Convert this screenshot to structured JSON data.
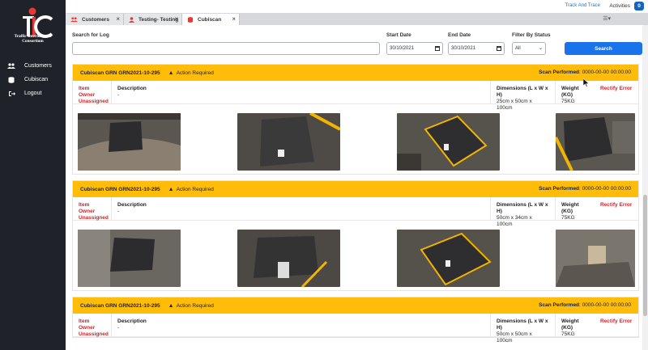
{
  "brand": {
    "logo_letters": "TIC",
    "line1": "Traffic International",
    "line2": "Consortium"
  },
  "sidebar": {
    "items": [
      {
        "label": "Customers",
        "icon": "users-icon"
      },
      {
        "label": "Cubiscan",
        "icon": "database-icon"
      },
      {
        "label": "Logout",
        "icon": "logout-icon"
      }
    ]
  },
  "topbar": {
    "track_link": "Track And Trace",
    "activities_label": "Activities",
    "activities_count": "0"
  },
  "tabs": [
    {
      "label": "Customers",
      "icon": "users-icon",
      "active": false
    },
    {
      "label": "Testing- Testing",
      "icon": "user-icon",
      "active": false
    },
    {
      "label": "Cubiscan",
      "icon": "database-icon",
      "active": true
    }
  ],
  "filters": {
    "search_label": "Search for Log",
    "search_value": "",
    "start_label": "Start Date",
    "start_value": "30/10/2021",
    "end_label": "End Date",
    "end_value": "30/10/2021",
    "status_label": "Filter By Status",
    "status_value": "All",
    "search_button": "Search"
  },
  "common": {
    "action_required": "Action Required",
    "scan_performed_label": "Scan Performed",
    "owner_label": "Item Owner",
    "owner_value": "Unassigned",
    "desc_label": "Description",
    "dim_label": "Dimensions (L x W x H)",
    "weight_label": "Weight (KG)",
    "rectify": "Rectify Error"
  },
  "logs": [
    {
      "grn": "Cubiscan GRN  GRN2021-10-295",
      "scan": ": 0000-00-00 00:00:00",
      "description": "-",
      "dimensions": "25cm x 50cm x 100cm",
      "weight": "75KG"
    },
    {
      "grn": "Cubiscan GRN  GRN2021-10-295",
      "scan": ": 0000-00-00 00:00:00",
      "description": "-",
      "dimensions": "50cm x 34cm x 100cm",
      "weight": "75KG"
    },
    {
      "grn": "Cubiscan GRN  GRN2021-10-295",
      "scan": ": 0000-00-00 00:00:00",
      "description": "-",
      "dimensions": "50cm x 50cm x 100cm",
      "weight": "75KG"
    }
  ],
  "colors": {
    "sidebar_bg": "#1f2329",
    "card_header": "#ffbd0a",
    "primary": "#1a73e8",
    "error_red": "#c62828"
  }
}
